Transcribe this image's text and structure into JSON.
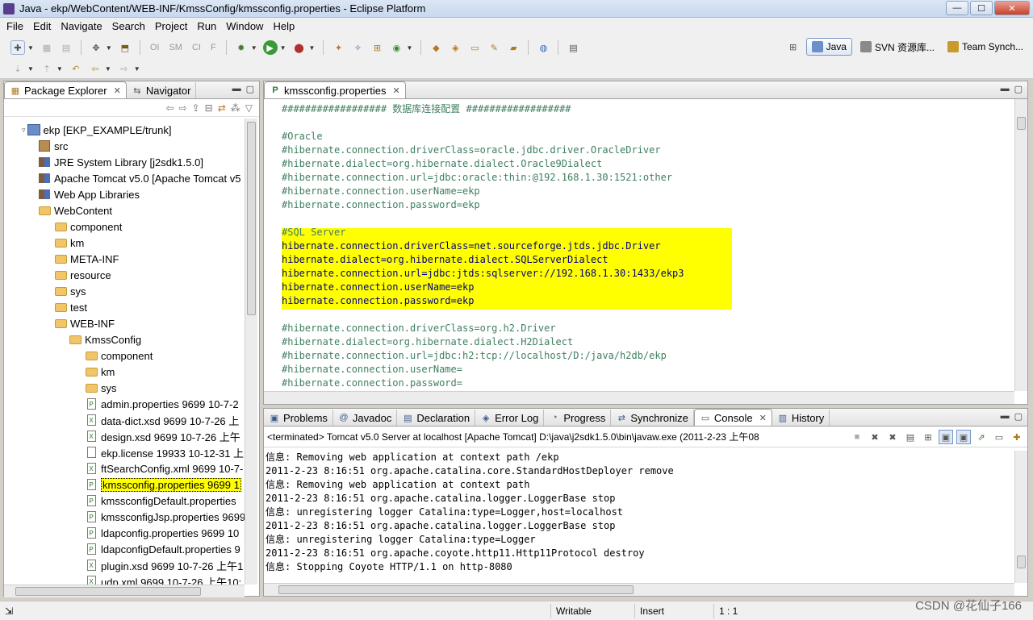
{
  "window": {
    "title": "Java - ekp/WebContent/WEB-INF/KmssConfig/kmssconfig.properties - Eclipse Platform",
    "min": "—",
    "max": "☐",
    "close": "✕"
  },
  "menu": [
    "File",
    "Edit",
    "Navigate",
    "Search",
    "Project",
    "Run",
    "Window",
    "Help"
  ],
  "toolbar": {
    "grayed": [
      "OI",
      "SM",
      "CI",
      "F"
    ]
  },
  "perspectives": [
    "Java",
    "SVN 资源库...",
    "Team Synch..."
  ],
  "package_explorer": {
    "tabs": [
      {
        "label": "Package Explorer",
        "active": true
      },
      {
        "label": "Navigator",
        "active": false
      }
    ],
    "tree": [
      {
        "label": "ekp [EKP_EXAMPLE/trunk]",
        "icon": "project",
        "level": 0,
        "expander": "▿"
      },
      {
        "label": "src",
        "icon": "package-folder",
        "level": 1
      },
      {
        "label": "JRE System Library [j2sdk1.5.0]",
        "icon": "library",
        "level": 1
      },
      {
        "label": "Apache Tomcat v5.0 [Apache Tomcat v5",
        "icon": "library",
        "level": 1
      },
      {
        "label": "Web App Libraries",
        "icon": "library",
        "level": 1
      },
      {
        "label": "WebContent",
        "icon": "folder",
        "level": 1
      },
      {
        "label": "component",
        "icon": "folder",
        "level": 2
      },
      {
        "label": "km",
        "icon": "folder",
        "level": 2
      },
      {
        "label": "META-INF",
        "icon": "folder",
        "level": 2
      },
      {
        "label": "resource",
        "icon": "folder",
        "level": 2
      },
      {
        "label": "sys",
        "icon": "folder",
        "level": 2
      },
      {
        "label": "test",
        "icon": "folder",
        "level": 2
      },
      {
        "label": "WEB-INF",
        "icon": "folder",
        "level": 2
      },
      {
        "label": "KmssConfig",
        "icon": "folder",
        "level": 3
      },
      {
        "label": "component",
        "icon": "folder",
        "level": 4
      },
      {
        "label": "km",
        "icon": "folder",
        "level": 4
      },
      {
        "label": "sys",
        "icon": "folder",
        "level": 4
      },
      {
        "label": "admin.properties 9699  10-7-2",
        "icon": "file-p",
        "level": 4
      },
      {
        "label": "data-dict.xsd 9699  10-7-26 上",
        "icon": "file-x",
        "level": 4
      },
      {
        "label": "design.xsd 9699  10-7-26 上午",
        "icon": "file-x",
        "level": 4
      },
      {
        "label": "ekp.license 19933  10-12-31 上",
        "icon": "file",
        "level": 4
      },
      {
        "label": "ftSearchConfig.xml 9699  10-7-",
        "icon": "file-x",
        "level": 4
      },
      {
        "label": "kmssconfig.properties 9699  1",
        "icon": "file-p",
        "level": 4,
        "selected": true
      },
      {
        "label": "kmssconfigDefault.properties",
        "icon": "file-p",
        "level": 4
      },
      {
        "label": "kmssconfigJsp.properties 9699",
        "icon": "file-p",
        "level": 4
      },
      {
        "label": "ldapconfig.properties 9699  10",
        "icon": "file-p",
        "level": 4
      },
      {
        "label": "ldapconfigDefault.properties 9",
        "icon": "file-p",
        "level": 4
      },
      {
        "label": "plugin.xsd 9699  10-7-26 上午1",
        "icon": "file-x",
        "level": 4
      },
      {
        "label": "udp.xml 9699  10-7-26 上午10:",
        "icon": "file-x",
        "level": 4
      }
    ]
  },
  "editor": {
    "tab": "kmssconfig.properties",
    "lines": [
      {
        "text": "################## 数据库连接配置 ##################",
        "style": "comment"
      },
      {
        "text": "",
        "style": "plain"
      },
      {
        "text": "#Oracle",
        "style": "comment"
      },
      {
        "text": "#hibernate.connection.driverClass=oracle.jdbc.driver.OracleDriver",
        "style": "comment"
      },
      {
        "text": "#hibernate.dialect=org.hibernate.dialect.Oracle9Dialect",
        "style": "comment"
      },
      {
        "text": "#hibernate.connection.url=jdbc:oracle:thin:@192.168.1.30:1521:other",
        "style": "comment"
      },
      {
        "text": "#hibernate.connection.userName=ekp",
        "style": "comment"
      },
      {
        "text": "#hibernate.connection.password=ekp",
        "style": "comment"
      },
      {
        "text": "",
        "style": "plain"
      },
      {
        "text": "#SQL Server",
        "style": "comment"
      },
      {
        "text": "hibernate.connection.driverClass=net.sourceforge.jtds.jdbc.Driver",
        "style": "key"
      },
      {
        "text": "hibernate.dialect=org.hibernate.dialect.SQLServerDialect",
        "style": "key"
      },
      {
        "text": "hibernate.connection.url=jdbc:jtds:sqlserver://192.168.1.30:1433/ekp3",
        "style": "key"
      },
      {
        "text": "hibernate.connection.userName=ekp",
        "style": "key"
      },
      {
        "text": "hibernate.connection.password=ekp",
        "style": "key"
      },
      {
        "text": "",
        "style": "plain"
      },
      {
        "text": "#hibernate.connection.driverClass=org.h2.Driver",
        "style": "comment"
      },
      {
        "text": "#hibernate.dialect=org.hibernate.dialect.H2Dialect",
        "style": "comment"
      },
      {
        "text": "#hibernate.connection.url=jdbc:h2:tcp://localhost/D:/java/h2db/ekp",
        "style": "comment"
      },
      {
        "text": "#hibernate.connection.userName=",
        "style": "comment"
      },
      {
        "text": "#hibernate.connection.password=",
        "style": "comment"
      }
    ]
  },
  "console": {
    "tabs": [
      {
        "label": "Problems",
        "icon": "▣"
      },
      {
        "label": "Javadoc",
        "icon": "@"
      },
      {
        "label": "Declaration",
        "icon": "▤"
      },
      {
        "label": "Error Log",
        "icon": "◈"
      },
      {
        "label": "Progress",
        "icon": "◔"
      },
      {
        "label": "Synchronize",
        "icon": "⇄"
      },
      {
        "label": "Console",
        "icon": "▭",
        "active": true
      },
      {
        "label": "History",
        "icon": "▥"
      }
    ],
    "status": "<terminated> Tomcat v5.0 Server at localhost [Apache Tomcat] D:\\java\\j2sdk1.5.0\\bin\\javaw.exe (2011-2-23 上午08",
    "lines": [
      "信息: Removing web application at context path /ekp",
      "2011-2-23 8:16:51 org.apache.catalina.core.StandardHostDeployer remove",
      "信息: Removing web application at context path",
      "2011-2-23 8:16:51 org.apache.catalina.logger.LoggerBase stop",
      "信息: unregistering logger Catalina:type=Logger,host=localhost",
      "2011-2-23 8:16:51 org.apache.catalina.logger.LoggerBase stop",
      "信息: unregistering logger Catalina:type=Logger",
      "2011-2-23 8:16:51 org.apache.coyote.http11.Http11Protocol destroy",
      "信息: Stopping Coyote HTTP/1.1 on http-8080"
    ]
  },
  "statusbar": {
    "writable": "Writable",
    "insert": "Insert",
    "position": "1 : 1"
  },
  "watermark": "CSDN @花仙子166",
  "colors": {
    "highlight": "#ffff00",
    "comment": "#3f7f5f",
    "key": "#000080"
  }
}
